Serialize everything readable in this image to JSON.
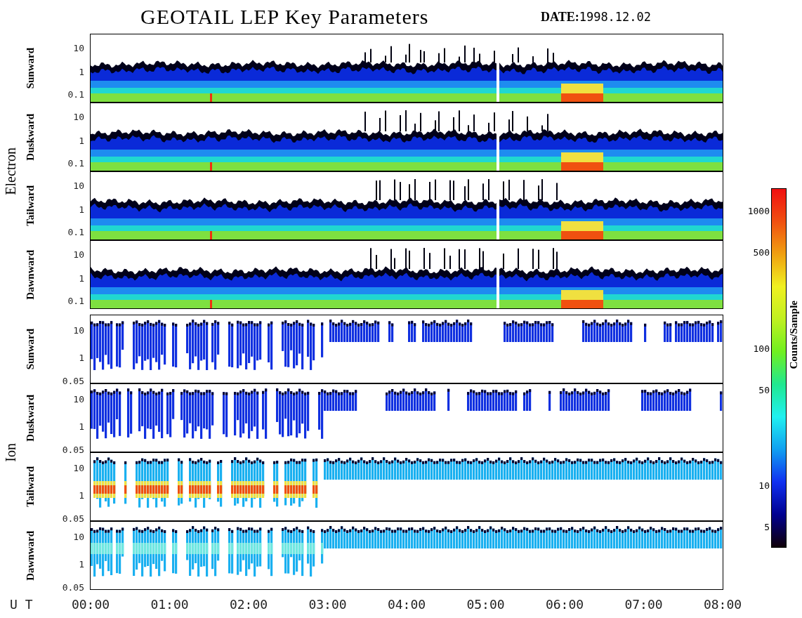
{
  "title": "GEOTAIL LEP Key Parameters",
  "date": {
    "label": "DATE:",
    "value": "1998.12.02"
  },
  "groups": [
    {
      "name": "Electron",
      "panels": [
        {
          "label": "Sunward",
          "kind": "electron",
          "yticks": [
            "10",
            "1",
            "0.1"
          ]
        },
        {
          "label": "Duskward",
          "kind": "electron",
          "yticks": [
            "10",
            "1",
            "0.1"
          ]
        },
        {
          "label": "Tailward",
          "kind": "electron",
          "yticks": [
            "10",
            "1",
            "0.1"
          ]
        },
        {
          "label": "Dawnward",
          "kind": "electron",
          "yticks": [
            "10",
            "1",
            "0.1"
          ]
        }
      ]
    },
    {
      "name": "Ion",
      "panels": [
        {
          "label": "Sunward",
          "kind": "ion",
          "yticks": [
            "10",
            "1",
            "0.05"
          ]
        },
        {
          "label": "Duskward",
          "kind": "ion",
          "yticks": [
            "10",
            "1",
            "0.05"
          ]
        },
        {
          "label": "Tailward",
          "kind": "ion-hot",
          "yticks": [
            "10",
            "1",
            "0.05"
          ]
        },
        {
          "label": "Dawnward",
          "kind": "ion-warm",
          "yticks": [
            "10",
            "1",
            "0.05"
          ]
        }
      ]
    }
  ],
  "colorbar": {
    "title": "Counts/Sample",
    "ticks": [
      "1000",
      "500",
      "100",
      "50",
      "10",
      "5"
    ]
  },
  "xaxis": {
    "label": "U T",
    "ticks": [
      "00:00",
      "01:00",
      "02:00",
      "03:00",
      "04:00",
      "05:00",
      "06:00",
      "07:00",
      "08:00"
    ]
  }
}
